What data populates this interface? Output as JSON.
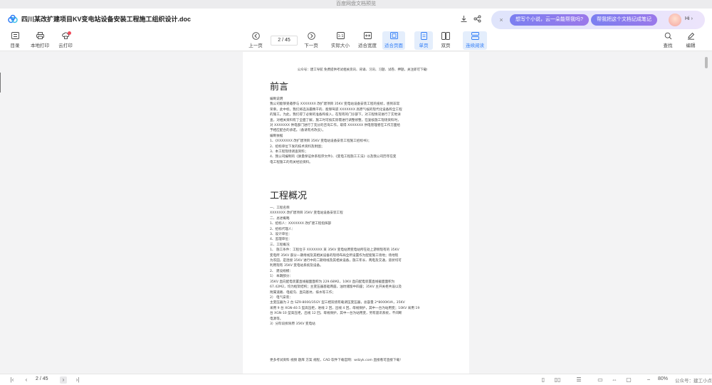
{
  "window": {
    "caption": "百度网盘文档预览"
  },
  "header": {
    "title": "四川某改扩建项目KV变电站设备安装工程施工组织设计.doc",
    "ai_chip_1": "想写个小说，云一朵能帮我吗?",
    "ai_chip_2": "帮我把这个文档记成笔记",
    "ai_greeting": "Hi",
    "ai_close": "×"
  },
  "toolbar": {
    "toc": "目录",
    "local_print": "本地打印",
    "cloud_print": "云打印",
    "prev": "上一页",
    "page_indicator": "2 / 45",
    "next": "下一页",
    "actual_size": "实际大小",
    "fit_width": "适合宽度",
    "fit_page": "适合页面",
    "single": "单页",
    "double": "双页",
    "continuous": "连续阅读",
    "find": "查找",
    "edit": "编辑"
  },
  "document": {
    "header_line": "公众号：建工导航 免费提供考试相关资讯、背诵、习讯、习题、试卷、押题，关注即可下载!",
    "section1_title": "前言",
    "section1_lines": [
      "编制说明",
      "我公司能够受邀参与 XXXXXXX 改扩建项目 35KV 变电站设备安装工程的投标，感到非常",
      "荣幸。此中标，我们将选派最精干的、能够驾驭 XXXXXXX 高原气候的现代化设备和全工程",
      "的施工。为此，我们得了必要的准备和投入，在现有的门诊部下，对工程情况进行了实地详",
      "查，对相关资料有了全面了解，施工时可按实际需进行调整修整，在复核施工现场资料时，",
      "对 XXXXXXX 供电部门进行了充分的咨询工作，取得 XXXXXXX 供电管理者在工作方面给",
      "予相应配合的承诺。（备请有点改良）。",
      "编制依据",
      "1、《XXXXXXX 改扩建项目 35KV 变电站设备安装工程施工招标书》；",
      "2、招标单位下发的技术资料及附图；",
      "3、本工程现场调查资料；",
      "4、我公司编制的《质量保证体系程序文件》、《变电工程施工工法》以及我公司历年在变",
      "电工程施工的有关经验资料。"
    ],
    "section2_title": "工程概况",
    "section2_lines": [
      "一、工程名称",
      "XXXXXXX 改扩建项目 35KV 变电站设备安装工程",
      "二、总述概略",
      "1、招标人：XXXXXXX 改扩建工程指挥部",
      "2、招标代理人：",
      "3、设计单位：",
      "4、监理单位：",
      "三、工程概况",
      "1、 施工条件：工程位于 XXXXXXX 某 35KV 变电站原变电站所在处上游侧现有的 35KV",
      "变电所 35KV 部分一期母线及其相关设备的现场布局全所设置作为配套施工场地；场地现",
      "为农田，是连接 35KV 进行中的二期母线及其相关设备，施工年长、两电及交通，道状均可",
      "利用现有 35KV 变电站系统及设备。",
      "2、 建设规模：",
      "1） 本期部分：",
      "35KV 直向配电装置直线截面面积为 229.68M2，10KV 直向配电装置直线截面面积为",
      "67.42M2，均为框架结构；主变压器基础两座，油坑储留中四座；35KV 主开关柜共设以及",
      "附属道路、电缆沟、直向基坑、排水等工作；",
      "2） 电气安装：",
      "主变压器为 2 台 SZ9-8000/35GY 型三相双绕有载调压变压器，总容量 2*8000KVA，35KV",
      "采用 9 台 XGN-40.5 型高压柜，进线 2 回，出线 4 回，母线保护，其中一台为站用变；10KV 采用 19",
      "台 XGN-10 型高压柜，出线 12 回，母线保护，其中一台为站用变，另有遥讯系统，不间断",
      "电源等。",
      "3）分阶段拆除原 35KV 变电站"
    ],
    "footer_line": "更多考试资料 视频 题库 方案 规程，CAD 软件下载官网：wdzyk.com 直接看可直接下载!"
  },
  "statusbar": {
    "page_indicator": "2 / 45",
    "zoom": "80%",
    "watermark": "公众号：建工小点"
  },
  "colors": {
    "accent": "#2f7cf6",
    "active_bg": "#e4eefc",
    "ai_chip": "#8a7bee",
    "badge": "#f04a5a"
  }
}
